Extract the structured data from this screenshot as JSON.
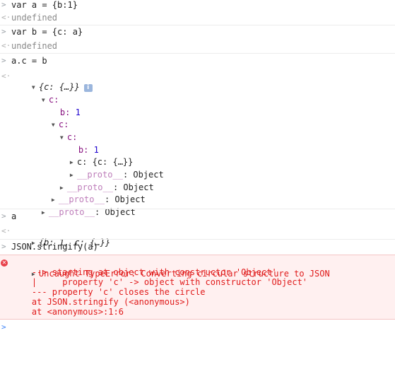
{
  "prompt_icon": "chevron-right-icon",
  "return_icon": "return-arrow-icon",
  "entries": {
    "cmd1": "var a = {b:1}",
    "ret1": "undefined",
    "cmd2": "var b = {c: a}",
    "ret2": "undefined",
    "cmd3": "a.c = b",
    "tree": {
      "root_preview": "{c: {…}}",
      "info_badge": "i",
      "c1_key": "c:",
      "b1_key": "b:",
      "b1_val": "1",
      "c2_key": "c:",
      "c3_key": "c:",
      "b2_key": "b:",
      "b2_val": "1",
      "c4_text": "c: {c: {…}}",
      "proto_label": "__proto__",
      "proto_value": ": Object"
    },
    "cmd4": "a",
    "a_preview": "{b: 1, c: {…}}",
    "cmd5": "JSON.stringify(a)",
    "error": {
      "line1": "Uncaught TypeError: Converting circular structure to JSON",
      "line2": "    --> starting at object with constructor 'Object'",
      "line3": "    |     property 'c' -> object with constructor 'Object'",
      "line4": "    --- property 'c' closes the circle",
      "line5": "    at JSON.stringify (<anonymous>)",
      "line6": "    at <anonymous>:1:6"
    }
  },
  "colors": {
    "error_text": "#e01b1b",
    "error_bg": "#fff0f0",
    "key": "#881280",
    "number": "#1c00cf",
    "prompt": "#3b82f6"
  }
}
